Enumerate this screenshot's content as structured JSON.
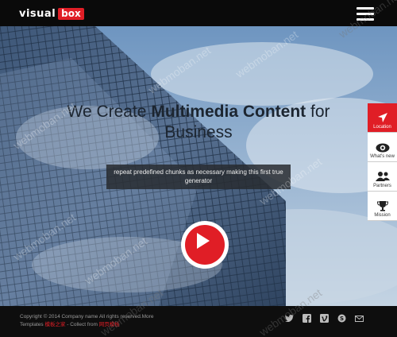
{
  "brand": {
    "word": "visual",
    "box": "box"
  },
  "hero": {
    "headline_pre": "We Create ",
    "headline_bold": "Multimedia Content",
    "headline_post": " for",
    "headline_line2": "Business",
    "subtext": "repeat predefined chunks as necessary making this first true generator"
  },
  "sidenav": [
    {
      "label": "Location",
      "icon": "location-arrow-icon",
      "active": true
    },
    {
      "label": "What's new",
      "icon": "eye-icon",
      "active": false
    },
    {
      "label": "Partners",
      "icon": "users-icon",
      "active": false
    },
    {
      "label": "Mission",
      "icon": "trophy-icon",
      "active": false
    }
  ],
  "footer": {
    "copyright": "Copyright © 2014 Company name All rights reserved.More",
    "templates_prefix": "Templates ",
    "templates_link": "模板之家",
    "collect_text": " - Collect from ",
    "collect_link": "网页模板"
  },
  "social": [
    "twitter-icon",
    "facebook-icon",
    "vimeo-icon",
    "skype-icon",
    "mail-icon"
  ],
  "watermark": "webmoban.net",
  "colors": {
    "accent": "#e01e26",
    "topbar": "#0a0a0a",
    "footer": "#0e0e0e"
  }
}
